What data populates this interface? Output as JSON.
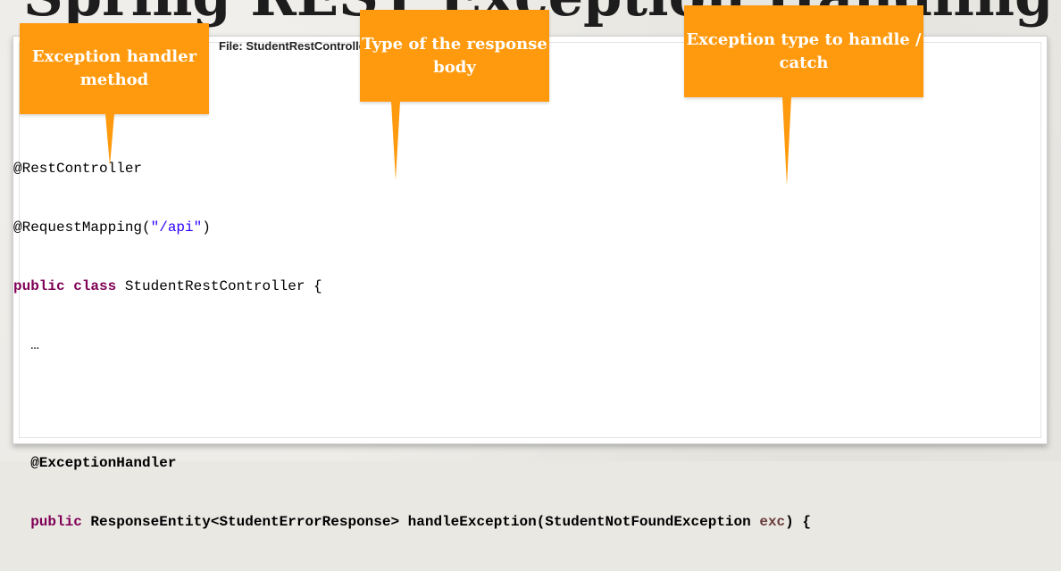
{
  "slide": {
    "title": "Spring REST Exception Handling"
  },
  "file": {
    "name": "File: StudentRestController.java"
  },
  "code": {
    "l1": {
      "anno": "@RestController"
    },
    "l2": {
      "anno": "@RequestMapping(",
      "str": "\"/api\"",
      "close": ")"
    },
    "l3": {
      "kw": "public class",
      "rest": " StudentRestController {"
    },
    "l4": {
      "text": "  …"
    },
    "l6": {
      "text": "  @ExceptionHandler"
    },
    "l7": {
      "indent": "  ",
      "kw": "public",
      "sig": " ResponseEntity<StudentErrorResponse> handleException(StudentNotFoundException ",
      "var": "exc",
      "end": ") {"
    }
  },
  "callouts": {
    "handler": "Exception handler method",
    "body_type": "Type of the response body",
    "exception_type": "Exception type to handle / catch"
  },
  "colors": {
    "callout": "#ff9a0e",
    "keyword": "#7f0055",
    "string": "#2a00ff",
    "variable": "#6a3e3e"
  }
}
